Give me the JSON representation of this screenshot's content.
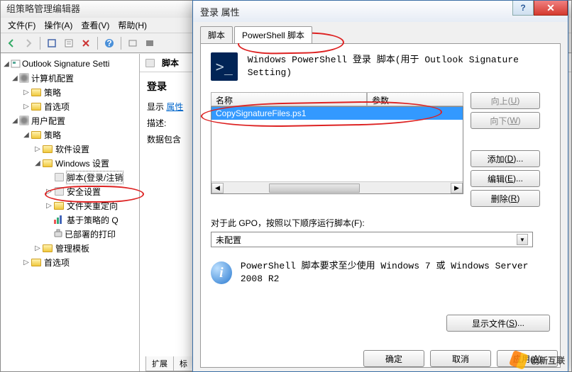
{
  "gpo": {
    "title": "组策略管理编辑器",
    "menu": [
      "文件(F)",
      "操作(A)",
      "查看(V)",
      "帮助(H)"
    ],
    "tree": {
      "root": "Outlook Signature Setti",
      "computer": "计算机配置",
      "computer_children": [
        "策略",
        "首选项"
      ],
      "user": "用户配置",
      "user_policy": "策略",
      "software": "软件设置",
      "windows": "Windows 设置",
      "scripts": "脚本(登录/注销",
      "security": "安全设置",
      "folder_redir": "文件夹重定向",
      "qos": "基于策略的 Q",
      "printers": "已部署的打印",
      "admin_templates": "管理模板",
      "user_prefs": "首选项"
    },
    "content": {
      "header_label": "脚本",
      "title": "登录",
      "show_label": "显示",
      "show_link": "属性",
      "desc_label": "描述:",
      "desc_text": "数据包含"
    },
    "bottom_tabs": [
      "扩展",
      "标"
    ]
  },
  "dialog": {
    "title": "登录 属性",
    "tabs": {
      "scripts": "脚本",
      "powershell": "PowerShell 脚本"
    },
    "header_text": "Windows PowerShell 登录 脚本(用于 Outlook Signature Setting)",
    "columns": {
      "name": "名称",
      "param": "参数"
    },
    "row1": "CopySignatureFiles.ps1",
    "buttons": {
      "up": "向上",
      "up_u": "U",
      "down": "向下",
      "down_u": "W",
      "add": "添加",
      "add_u": "D",
      "edit": "编辑",
      "edit_u": "E",
      "remove": "删除",
      "remove_u": "R",
      "ellipsis": "..."
    },
    "order_label": "对于此 GPO，按照以下顺序运行脚本(F):",
    "order_value": "未配置",
    "info_text": "PowerShell 脚本要求至少使用 Windows 7 或 Windows Server 2008 R2",
    "show_files": "显示文件",
    "show_files_u": "S",
    "footer": {
      "ok": "确定",
      "cancel": "取消",
      "apply": "应用(",
      "apply_u": "A",
      "apply_close": ")"
    }
  },
  "watermark": "创新互联"
}
